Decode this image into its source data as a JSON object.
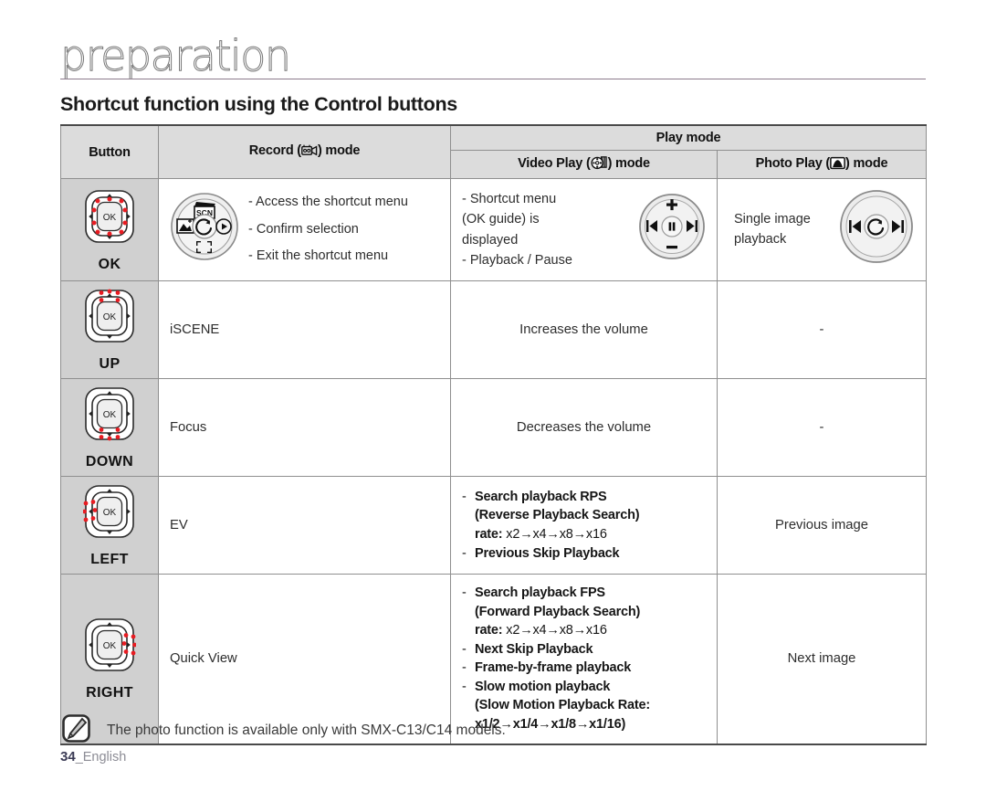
{
  "header": {
    "chapter": "preparation",
    "section_title": "Shortcut function using the Control buttons"
  },
  "table": {
    "columns": {
      "button": "Button",
      "record_pre": "Record (",
      "record_post": ") mode",
      "play_mode": "Play mode",
      "video_pre": "Video Play (",
      "video_post": ") mode",
      "photo_pre": "Photo Play (",
      "photo_post": ") mode",
      "record_icon": "camcorder-icon",
      "video_icon": "film-reel-icon",
      "photo_icon": "photo-icon"
    },
    "rows": [
      {
        "button_label": "OK",
        "button_icon": "control-pad-ok-icon",
        "record": {
          "dial_icon": "record-mode-dial-icon",
          "lines": [
            "- Access the shortcut menu",
            "- Confirm selection",
            "- Exit the shortcut menu"
          ]
        },
        "video": {
          "lines": [
            "- Shortcut menu",
            "   (OK guide) is",
            "   displayed",
            "- Playback / Pause"
          ],
          "dial_icon": "video-play-dial-icon"
        },
        "photo": {
          "lines": [
            "Single image",
            "playback"
          ],
          "dial_icon": "photo-play-dial-icon"
        }
      },
      {
        "button_label": "UP",
        "button_icon": "control-pad-up-icon",
        "record_text": "iSCENE",
        "video_text": "Increases the volume",
        "photo_text": "-"
      },
      {
        "button_label": "DOWN",
        "button_icon": "control-pad-down-icon",
        "record_text": "Focus",
        "video_text": "Decreases the volume",
        "photo_text": "-"
      },
      {
        "button_label": "LEFT",
        "button_icon": "control-pad-left-icon",
        "record_text": "EV",
        "video_bullets": [
          {
            "main": "Search playback RPS",
            "sub": "(Reverse Playback Search)",
            "rate_label": "rate:",
            "rate_value": "x2→x4→x8→x16"
          },
          {
            "main": "Previous Skip Playback"
          }
        ],
        "photo_text": "Previous image"
      },
      {
        "button_label": "RIGHT",
        "button_icon": "control-pad-right-icon",
        "record_text": "Quick View",
        "video_bullets": [
          {
            "main": "Search playback FPS",
            "sub": "(Forward Playback Search)",
            "rate_label": "rate:",
            "rate_value": "x2→x4→x8→x16"
          },
          {
            "main": "Next Skip Playback"
          },
          {
            "main": "Frame-by-frame playback"
          },
          {
            "main": "Slow motion playback",
            "sub": "(Slow Motion Playback Rate:",
            "rate_value2": "x1/2→x1/4→x1/8→x1/16)"
          }
        ],
        "photo_text": "Next image"
      }
    ]
  },
  "footer": {
    "note_icon": "note-pencil-icon",
    "note_text": "The photo function is available only with SMX-C13/C14 models.",
    "page_number": "34",
    "page_language": "_English"
  },
  "colors": {
    "accent_rule": "#8c7a8c",
    "header_bg": "#dcdcdc",
    "button_col_bg": "#d0d0d0",
    "red_dot": "#e81c22",
    "border": "#8f8f8f"
  }
}
